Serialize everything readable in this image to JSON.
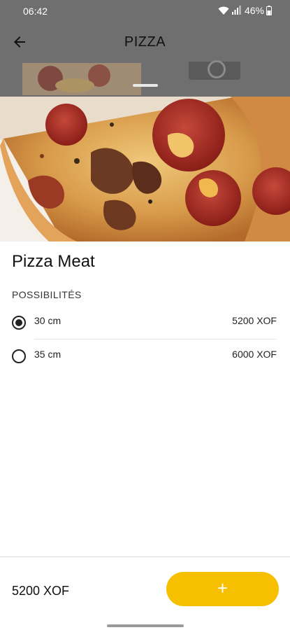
{
  "status_bar": {
    "time": "06:42",
    "battery_text": "46%",
    "icons": [
      "wifi-icon",
      "signal-icon",
      "battery-icon"
    ]
  },
  "app_bar": {
    "title": "PIZZA",
    "back_icon": "arrow-back-icon"
  },
  "product": {
    "name": "Pizza Meat",
    "image": "pizza-meat-photo"
  },
  "options_section": {
    "label": "POSSIBILITÉS",
    "options": [
      {
        "label": "30 cm",
        "price": "5200 XOF",
        "selected": true
      },
      {
        "label": "35 cm",
        "price": "6000 XOF",
        "selected": false
      }
    ]
  },
  "footer": {
    "total": "5200 XOF",
    "add_label": "+"
  },
  "colors": {
    "accent": "#f6c000",
    "scrim": "#6f6f6f"
  }
}
